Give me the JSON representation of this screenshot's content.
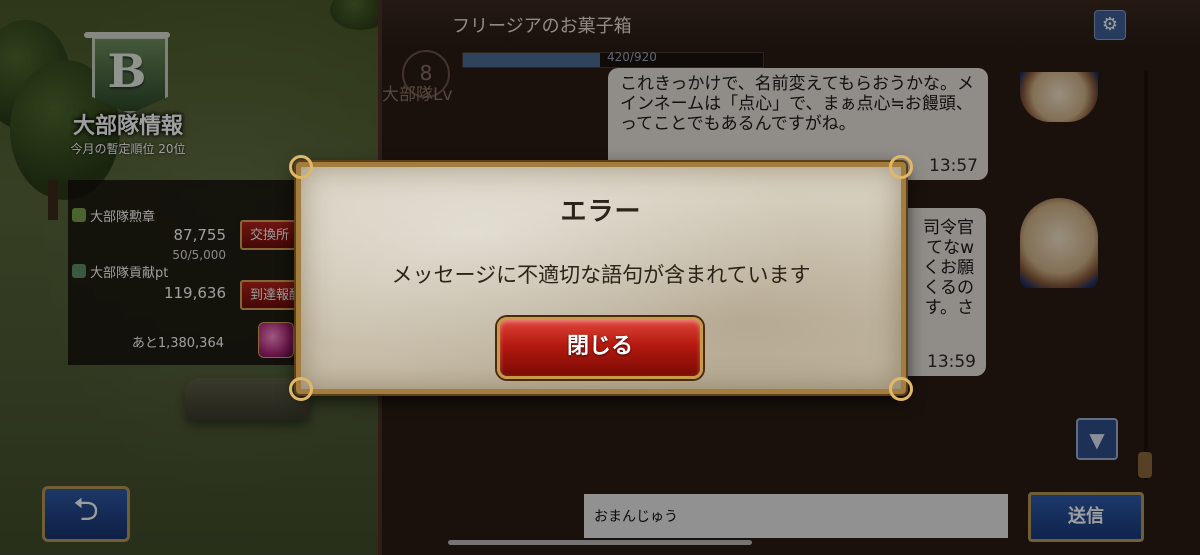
{
  "guild": {
    "emblem_letter": "B",
    "title": "大部隊情報",
    "rank": "今月の暫定順位 20位",
    "medal_label": "大部隊勲章",
    "medal_value": "87,755",
    "medal_limit": "50/5,000",
    "exchange_button": "交換所",
    "contrib_label": "大部隊貢献pt",
    "contrib_value": "119,636",
    "reward_button": "到達報酬",
    "remaining": "あと1,380,364"
  },
  "chat": {
    "title": "フリージアのお菓子箱",
    "level_number": "8",
    "level_label": "大部隊Lv",
    "level_progress_text": "420/920",
    "level_progress": 0.457,
    "messages": [
      {
        "text": "これきっかけで、名前変えてもらおうかな。メインネームは「点心」で、まぁ点心≒お饅頭、ってことでもあるんですがね。",
        "time": "13:57"
      },
      {
        "text_partial": [
          "司令官",
          "てなw",
          "くお願",
          "くるの",
          "す。さ"
        ],
        "time": "13:59"
      }
    ],
    "input_value": "おまんじゅう",
    "send_button": "送信"
  },
  "dialog": {
    "title": "エラー",
    "message": "メッセージに不適切な語句が含まれています",
    "close_button": "閉じる"
  },
  "icons": {
    "settings": "gear-icon",
    "scroll_down": "triangle-down-icon",
    "back": "return-arrow-icon"
  },
  "colors": {
    "accent_red": "#b4190f",
    "accent_blue": "#2e4f8a",
    "gold_frame": "#a27d3e"
  }
}
